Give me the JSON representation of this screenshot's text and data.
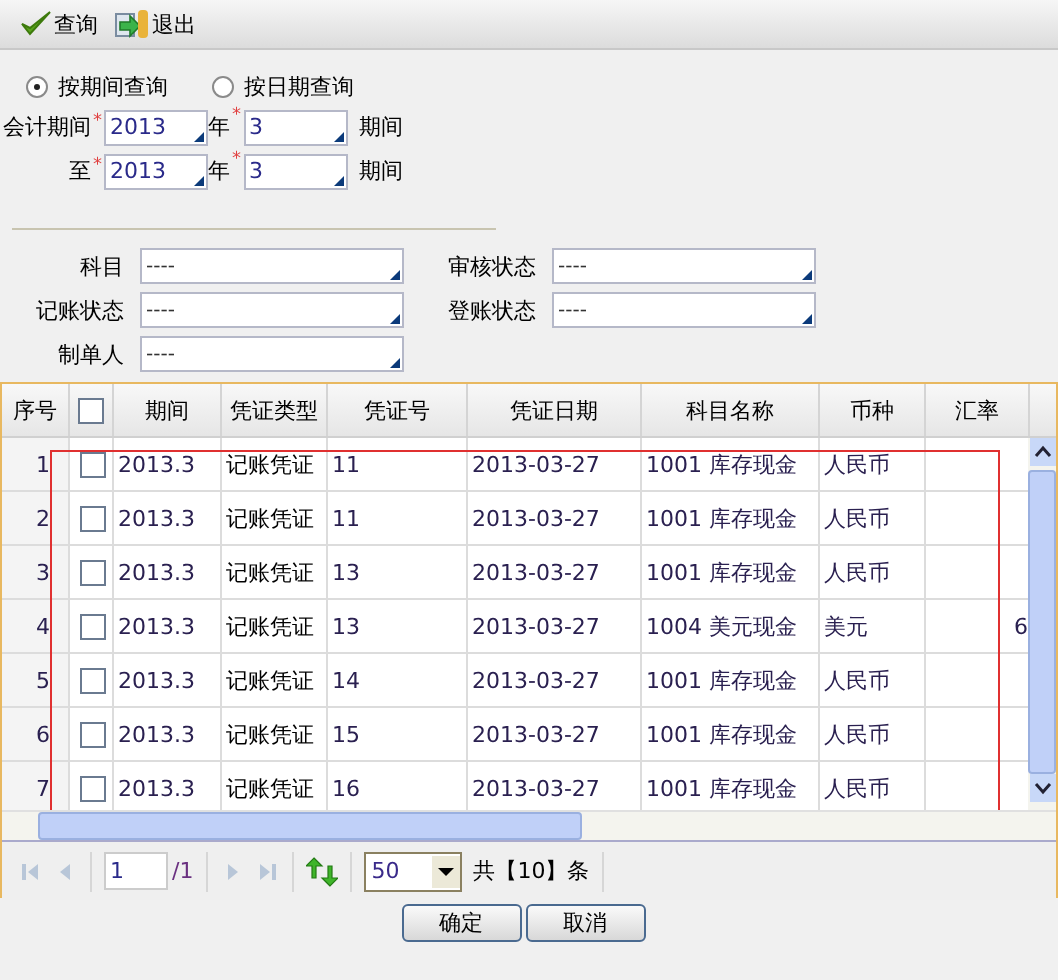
{
  "toolbar": [
    {
      "label": "查询",
      "kind": "check"
    },
    {
      "label": "退出",
      "kind": "exit"
    }
  ],
  "query_mode": [
    {
      "label": "按期间查询",
      "selected": true
    },
    {
      "label": "按日期查询",
      "selected": false
    }
  ],
  "period_rows": [
    {
      "label": "会计期间",
      "mark": "*",
      "year": "2013",
      "year_label": "年",
      "period": "3",
      "unit": "期间"
    },
    {
      "label": "至",
      "mark": "*",
      "year": "2013",
      "year_label": "年",
      "period": "3",
      "unit": "期间"
    }
  ],
  "filters": [
    {
      "label": "科目",
      "value": "----"
    },
    {
      "label": "审核状态",
      "value": "----"
    },
    {
      "label": "记账状态",
      "value": "----"
    },
    {
      "label": "登账状态",
      "value": "----"
    },
    {
      "label": "制单人",
      "value": "----"
    }
  ],
  "table": {
    "columns": [
      "序号",
      "期间",
      "凭证类型",
      "凭证号",
      "凭证日期",
      "科目名称",
      "币种",
      "汇率"
    ],
    "header_checked": false,
    "rows": [
      {
        "index": "1",
        "checked": false,
        "period": "2013.3",
        "type": "记账凭证",
        "number": "11",
        "date": "2013-03-27",
        "account": "1001 库存现金",
        "currency": "人民币",
        "rate": ""
      },
      {
        "index": "2",
        "checked": false,
        "period": "2013.3",
        "type": "记账凭证",
        "number": "11",
        "date": "2013-03-27",
        "account": "1001 库存现金",
        "currency": "人民币",
        "rate": ""
      },
      {
        "index": "3",
        "checked": false,
        "period": "2013.3",
        "type": "记账凭证",
        "number": "13",
        "date": "2013-03-27",
        "account": "1001 库存现金",
        "currency": "人民币",
        "rate": ""
      },
      {
        "index": "4",
        "checked": false,
        "period": "2013.3",
        "type": "记账凭证",
        "number": "13",
        "date": "2013-03-27",
        "account": "1004 美元现金",
        "currency": "美元",
        "rate": "6"
      },
      {
        "index": "5",
        "checked": false,
        "period": "2013.3",
        "type": "记账凭证",
        "number": "14",
        "date": "2013-03-27",
        "account": "1001 库存现金",
        "currency": "人民币",
        "rate": ""
      },
      {
        "index": "6",
        "checked": false,
        "period": "2013.3",
        "type": "记账凭证",
        "number": "15",
        "date": "2013-03-27",
        "account": "1001 库存现金",
        "currency": "人民币",
        "rate": ""
      },
      {
        "index": "7",
        "checked": false,
        "period": "2013.3",
        "type": "记账凭证",
        "number": "16",
        "date": "2013-03-27",
        "account": "1001 库存现金",
        "currency": "人民币",
        "rate": ""
      }
    ]
  },
  "pager": {
    "page": "1",
    "total_pages": "/1",
    "page_size": "50",
    "summary": "共【10】条"
  },
  "buttons": [
    "确定",
    "取消"
  ]
}
